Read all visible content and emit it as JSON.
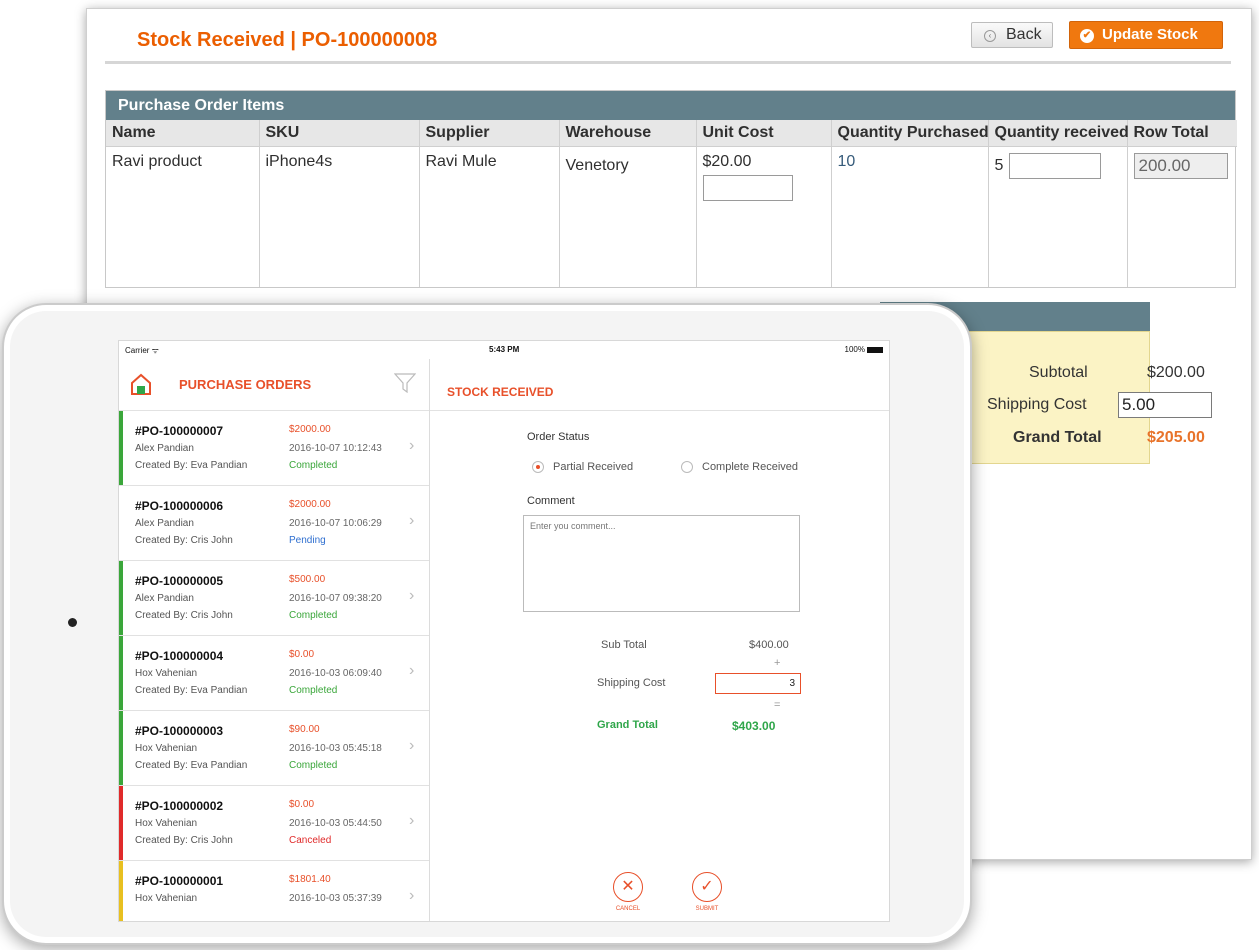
{
  "admin": {
    "title": "Stock Received | PO-100000008",
    "back_label": "Back",
    "update_label": "Update Stock",
    "section_title": "Purchase Order Items",
    "columns": [
      "Name",
      "SKU",
      "Supplier",
      "Warehouse",
      "Unit Cost",
      "Quantity Purchased",
      "Quantity received",
      "Row Total"
    ],
    "row": {
      "name": "Ravi product",
      "sku": "iPhone4s",
      "supplier": "Ravi Mule",
      "warehouse": "Venetory",
      "unit_cost": "$20.00",
      "qty_purchased": "10",
      "qty_received": "5",
      "row_total": "200.00"
    },
    "totals": {
      "subtotal_label": "Subtotal",
      "subtotal_value": "$200.00",
      "shipping_label": "Shipping Cost",
      "shipping_value": "5.00",
      "grand_label": "Grand Total",
      "grand_value": "$205.00"
    }
  },
  "tablet": {
    "status": {
      "carrier": "Carrier ᯤ",
      "time": "5:43 PM",
      "battery": "100%"
    },
    "list_title": "PURCHASE ORDERS",
    "orders": [
      {
        "id": "#PO-100000007",
        "customer": "Alex Pandian",
        "created_by": "Created By: Eva Pandian",
        "amount": "$2000.00",
        "date": "2016-10-07 10:12:43",
        "status": "Completed",
        "status_color": "#3aa63a",
        "bar_color": "#3aa63a"
      },
      {
        "id": "#PO-100000006",
        "customer": "Alex Pandian",
        "created_by": "Created By: Cris John",
        "amount": "$2000.00",
        "date": "2016-10-07 10:06:29",
        "status": "Pending",
        "status_color": "#2f6fd0",
        "bar_color": "#ffffff"
      },
      {
        "id": "#PO-100000005",
        "customer": "Alex Pandian",
        "created_by": "Created By: Cris John",
        "amount": "$500.00",
        "date": "2016-10-07 09:38:20",
        "status": "Completed",
        "status_color": "#3aa63a",
        "bar_color": "#3aa63a"
      },
      {
        "id": "#PO-100000004",
        "customer": "Hox Vahenian",
        "created_by": "Created By: Eva Pandian",
        "amount": "$0.00",
        "date": "2016-10-03 06:09:40",
        "status": "Completed",
        "status_color": "#3aa63a",
        "bar_color": "#3aa63a"
      },
      {
        "id": "#PO-100000003",
        "customer": "Hox Vahenian",
        "created_by": "Created By: Eva Pandian",
        "amount": "$90.00",
        "date": "2016-10-03 05:45:18",
        "status": "Completed",
        "status_color": "#3aa63a",
        "bar_color": "#3aa63a"
      },
      {
        "id": "#PO-100000002",
        "customer": "Hox Vahenian",
        "created_by": "Created By: Cris John",
        "amount": "$0.00",
        "date": "2016-10-03 05:44:50",
        "status": "Canceled",
        "status_color": "#e02a2a",
        "bar_color": "#e02a2a"
      },
      {
        "id": "#PO-100000001",
        "customer": "Hox Vahenian",
        "created_by": "",
        "amount": "$1801.40",
        "date": "2016-10-03 05:37:39",
        "status": "",
        "status_color": "#e0b020",
        "bar_color": "#e8c020"
      }
    ],
    "detail": {
      "title": "STOCK RECEIVED",
      "order_status_label": "Order Status",
      "radio_partial": "Partial Received",
      "radio_complete": "Complete Received",
      "comment_label": "Comment",
      "comment_placeholder": "Enter you comment...",
      "subtotal_label": "Sub Total",
      "subtotal_value": "$400.00",
      "plus": "+",
      "shipping_label": "Shipping Cost",
      "shipping_value": "3",
      "equals": "=",
      "grand_label": "Grand Total",
      "grand_value": "$403.00",
      "cancel_label": "CANCEL",
      "submit_label": "SUBMIT"
    }
  },
  "colors": {
    "accent": "#eb5e00",
    "header_bar": "#62808b",
    "totals_bg": "#fbf3c5",
    "green": "#2fa64a"
  }
}
